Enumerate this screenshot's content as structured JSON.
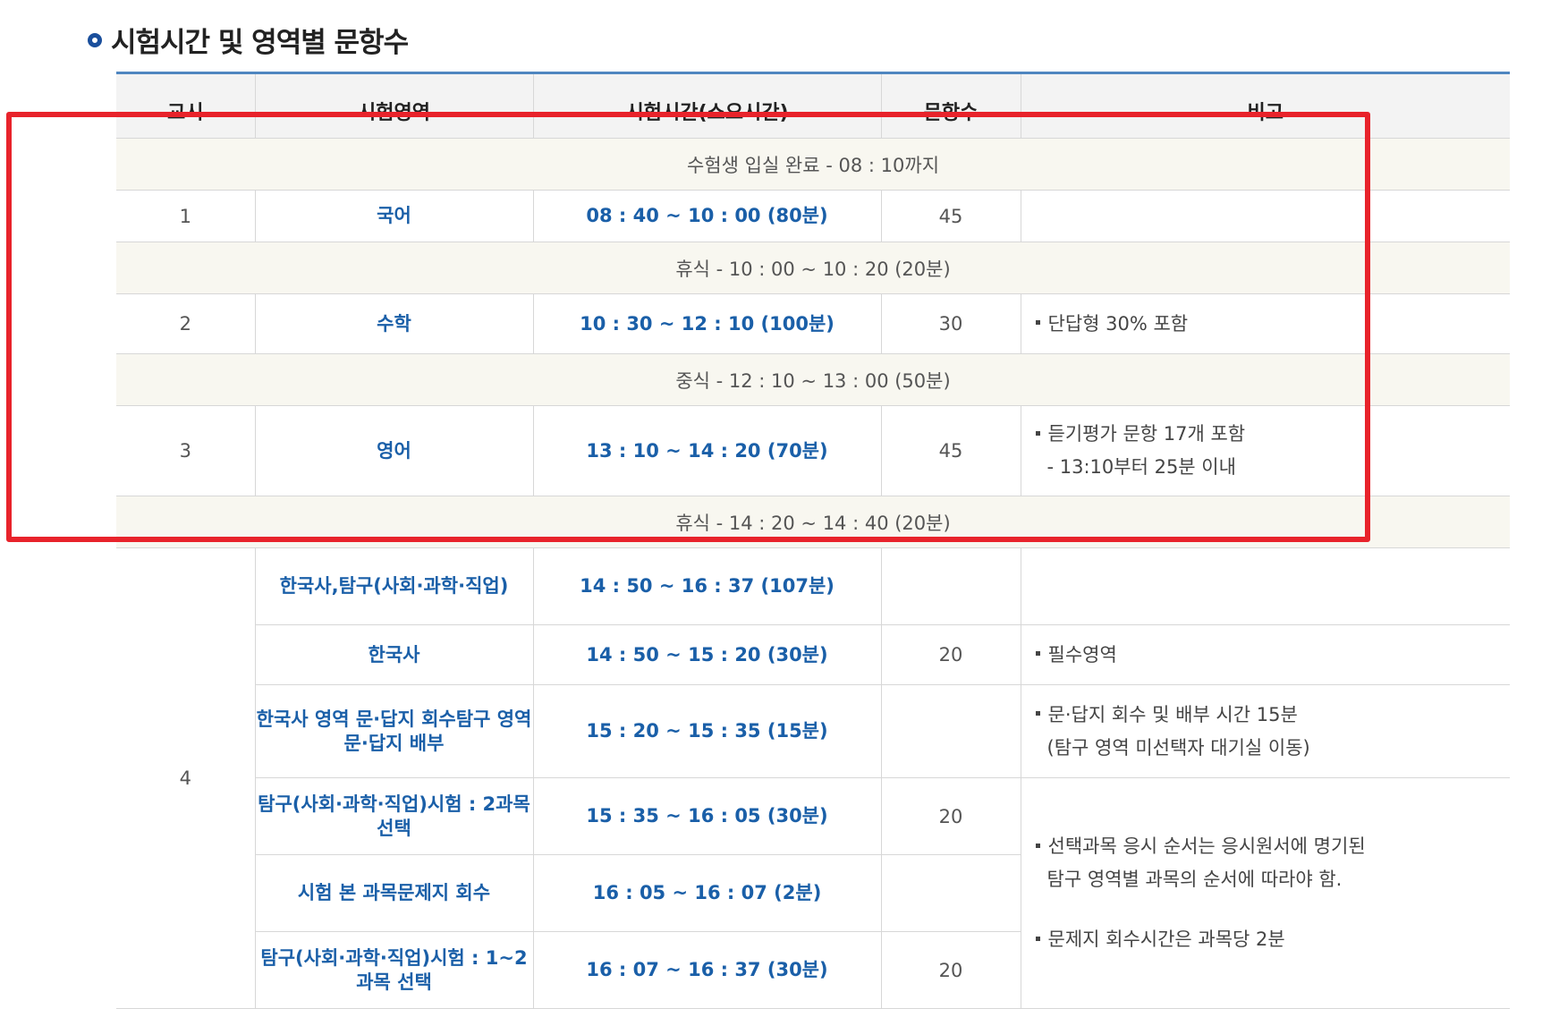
{
  "title": "시험시간 및 영역별 문항수",
  "headers": [
    "교시",
    "시험영역",
    "시험시간(소요시간)",
    "문항수",
    "비고"
  ],
  "bands": {
    "entry": "수험생 입실 완료 - 08 : 10까지",
    "break1": "휴식 - 10 : 00 ~ 10 : 20 (20분)",
    "lunch": "중식 - 12 : 10 ~ 13 : 00 (50분)",
    "break2": "휴식 - 14 : 20 ~ 14 : 40 (20분)"
  },
  "rows": [
    {
      "period": "1",
      "subject": "국어",
      "time": "08 : 40 ~ 10 : 00 (80분)",
      "count": "45",
      "remark": []
    },
    {
      "period": "2",
      "subject": "수학",
      "time": "10 : 30 ~ 12 : 10 (100분)",
      "count": "30",
      "remark": [
        "단답형 30% 포함"
      ]
    },
    {
      "period": "3",
      "subject": "영어",
      "time": "13 : 10 ~ 14 : 20 (70분)",
      "count": "45",
      "remark": [
        "듣기평가 문항 17개 포함",
        "- 13:10부터 25분 이내"
      ]
    }
  ],
  "period4": {
    "period": "4",
    "rows": [
      {
        "subject": [
          "한국사,",
          "탐구(사회·과학·직업)"
        ],
        "time": "14 : 50 ~ 16 : 37 (107분)",
        "count": "",
        "remark": []
      },
      {
        "subject": [
          "한국사"
        ],
        "time": "14 : 50 ~ 15 : 20 (30분)",
        "count": "20",
        "remark": [
          "필수영역"
        ]
      },
      {
        "subject": [
          "한국사 영역 문·답지 회수",
          "탐구 영역 문·답지 배부"
        ],
        "time": "15 : 20 ~ 15 : 35 (15분)",
        "count": "",
        "remark": [
          "문·답지 회수 및 배부 시간 15분",
          "(탐구 영역 미선택자 대기실 이동)"
        ]
      },
      {
        "subject": [
          "탐구(사회·과학·직업)",
          "시험 : 2과목 선택"
        ],
        "time": "15 : 35 ~ 16 : 05 (30분)",
        "count": "20"
      },
      {
        "subject": [
          "시험 본 과목",
          "문제지 회수"
        ],
        "time": "16 : 05 ~ 16 : 07 (2분)",
        "count": ""
      },
      {
        "subject": [
          "탐구(사회·과학·직업)",
          "시험 : 1~2과목 선택"
        ],
        "time": "16 : 07 ~ 16 : 37 (30분)",
        "count": "20"
      }
    ],
    "merged_remark": [
      "선택과목 응시 순서는 응시원서에 명기된",
      "탐구 영역별 과목의 순서에 따라야 함.",
      "문제지 회수시간은 과목당 2분"
    ]
  },
  "colors": {
    "accent": "#1a5fa8",
    "highlight": "#e8232b",
    "band_bg": "#f8f7f0",
    "header_bg": "#f3f3f3"
  }
}
